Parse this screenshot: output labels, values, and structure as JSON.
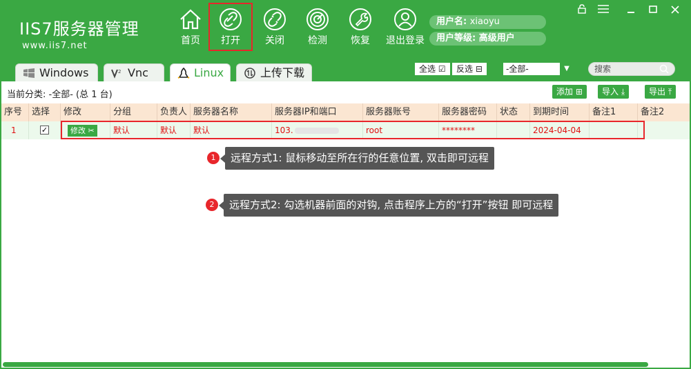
{
  "app": {
    "logo_main": "IIS7服务器管理",
    "logo_url": "www.iis7.net",
    "colors": {
      "brand": "#3aa843",
      "alert": "#e8262b",
      "row_text": "#e01010"
    }
  },
  "nav": {
    "home": "首页",
    "open": "打开",
    "close": "关闭",
    "detect": "检测",
    "restore": "恢复",
    "logout": "退出登录"
  },
  "user": {
    "name_label": "用户名: ",
    "name": "xiaoyu",
    "level_label": "用户等级: ",
    "level": "高级用户"
  },
  "tabs": [
    {
      "label": "Windows",
      "icon": "windows-icon"
    },
    {
      "label": "Vnc",
      "icon": "vnc-icon"
    },
    {
      "label": "Linux",
      "icon": "linux-icon"
    },
    {
      "label": "上传下载",
      "icon": "upload-download-icon"
    }
  ],
  "toolbar": {
    "select_all": "全选",
    "invert_select": "反选",
    "filter_value": "-全部-",
    "search_placeholder": "搜索",
    "category_label": "当前分类: ",
    "category_value": "-全部- (总 1 台)",
    "add": "添加",
    "import": "导入",
    "export": "导出"
  },
  "table": {
    "headers": [
      "序号",
      "选择",
      "修改",
      "分组",
      "负责人",
      "服务器名称",
      "服务器IP和端口",
      "服务器账号",
      "服务器密码",
      "状态",
      "到期时间",
      "备注1",
      "备注2"
    ],
    "row": {
      "index": "1",
      "checked": "✓",
      "edit": "修改",
      "group": "默认",
      "owner": "默认",
      "name": "默认",
      "ip": "103.",
      "account": "root",
      "password": "********",
      "status": "",
      "expire": "2024-04-04",
      "note1": "",
      "note2": ""
    }
  },
  "tips": [
    {
      "num": "1",
      "text": "远程方式1: 鼠标移动至所在行的任意位置, 双击即可远程"
    },
    {
      "num": "2",
      "text": "远程方式2: 勾选机器前面的对钩, 点击程序上方的“打开”按钮 即可远程"
    }
  ]
}
